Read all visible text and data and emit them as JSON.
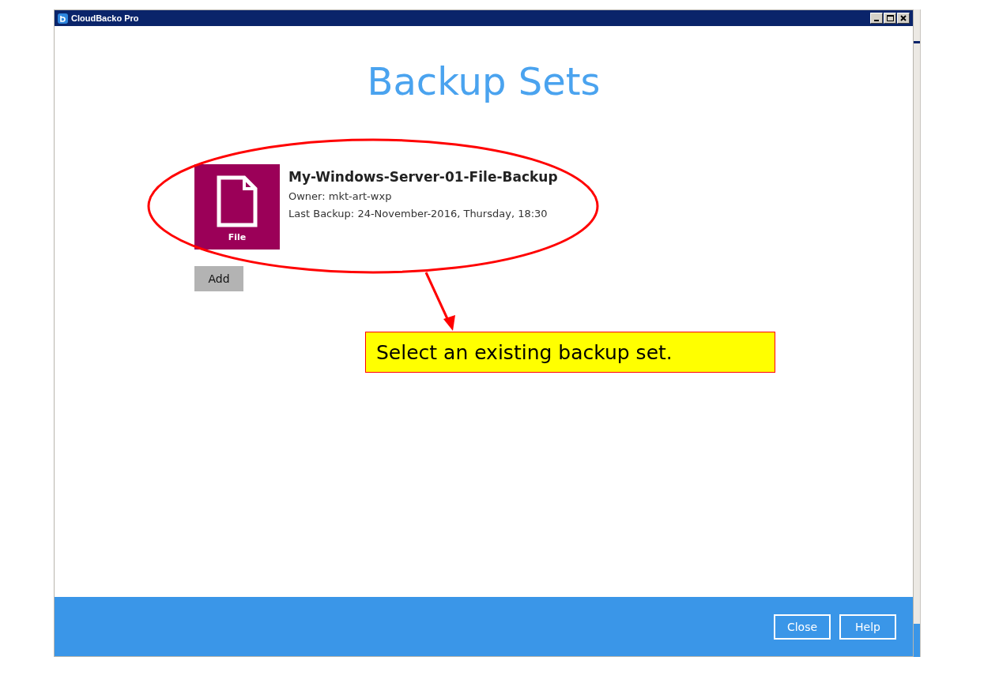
{
  "window": {
    "title": "CloudBacko Pro"
  },
  "heading": "Backup Sets",
  "backup_sets": [
    {
      "type_label": "File",
      "name": "My-Windows-Server-01-File-Backup",
      "owner": "Owner: mkt-art-wxp",
      "last_backup": "Last Backup: 24-November-2016, Thursday, 18:30"
    }
  ],
  "add_button": "Add",
  "footer_buttons": [
    "Close",
    "Help"
  ],
  "annotation": {
    "text": "Select an existing backup set."
  }
}
